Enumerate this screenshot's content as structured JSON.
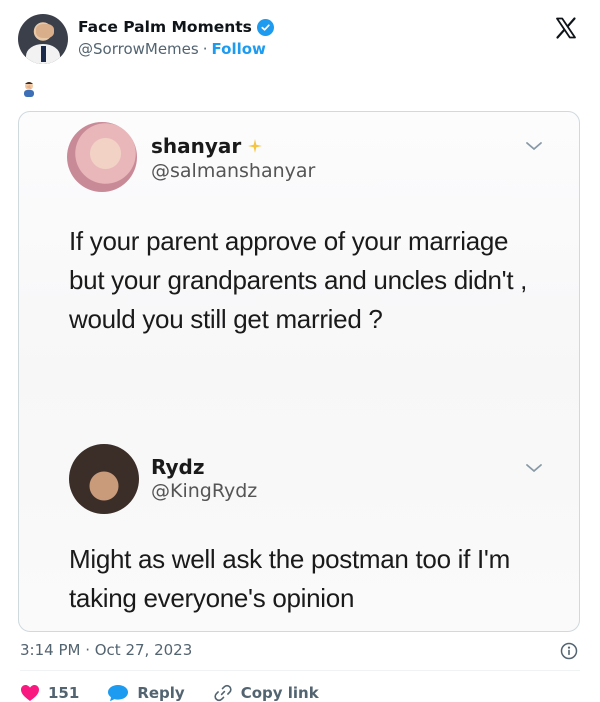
{
  "author": {
    "display_name": "Face Palm Moments",
    "handle": "@SorrowMemes",
    "separator": "·",
    "follow_label": "Follow"
  },
  "tweet_emoji": "🤦‍♂️",
  "embedded_image": {
    "tweets": [
      {
        "name": "shanyar",
        "handle": "@salmanshanyar",
        "text": "If your parent approve of your marriage but your grandparents and uncles didn't , would you still get married ?"
      },
      {
        "name": "Rydz",
        "handle": "@KingRydz",
        "text": "Might as well ask the postman too if I'm taking everyone's opinion"
      }
    ]
  },
  "timestamp": "3:14 PM · Oct 27, 2023",
  "actions": {
    "like_count": "151",
    "reply_label": "Reply",
    "copy_link_label": "Copy link"
  },
  "colors": {
    "accent": "#1d9bf0",
    "like": "#f91880",
    "muted": "#536471"
  }
}
